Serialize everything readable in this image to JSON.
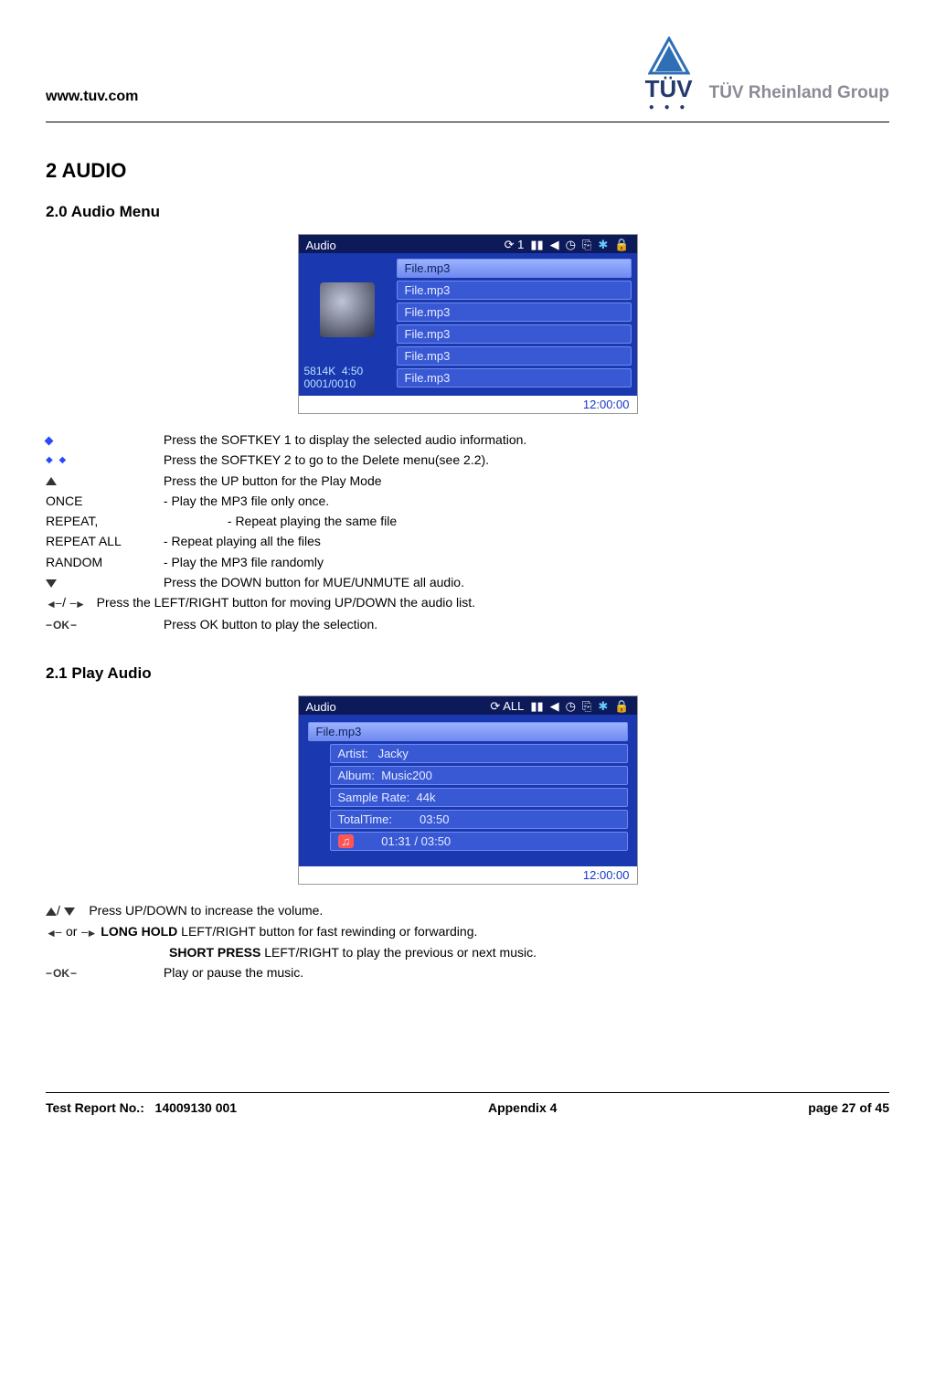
{
  "header": {
    "url": "www.tuv.com",
    "logo_text": "TÜV",
    "group_text": "TÜV Rheinland Group"
  },
  "section_heading": "2 AUDIO",
  "sub_20": "2.0 Audio Menu",
  "screen1": {
    "title": "Audio",
    "repeat_badge": "⟳ 1",
    "files": [
      "File.mp3",
      "File.mp3",
      "File.mp3",
      "File.mp3",
      "File.mp3",
      "File.mp3"
    ],
    "size": "5814K",
    "duration": "4:50",
    "index": "0001/0010",
    "clock": "12:00:00"
  },
  "instructions_20": {
    "softkey1": "Press the SOFTKEY 1 to display the selected audio information.",
    "softkey2": "Press the SOFTKEY 2 to go to the Delete menu(see 2.2).",
    "up": "Press the UP button for the Play Mode",
    "once_lbl": "ONCE",
    "once_txt": "- Play the MP3 file only once.",
    "repeat_lbl": "REPEAT,",
    "repeat_txt": "- Repeat playing the same file",
    "repeatall_lbl": "REPEAT ALL",
    "repeatall_txt": "- Repeat playing all the files",
    "random_lbl": "RANDOM",
    "random_txt": "- Play the MP3 file randomly",
    "down": "Press the DOWN button for MUE/UNMUTE all audio.",
    "lr": "Press the LEFT/RIGHT button for moving UP/DOWN the audio list.",
    "ok": "Press OK button to play the selection."
  },
  "sub_21": "2.1 Play Audio",
  "screen2": {
    "title": "Audio",
    "repeat_badge": "⟳ ALL",
    "file": "File.mp3",
    "artist_lbl": "Artist:",
    "artist_val": "Jacky",
    "album_lbl": "Album:",
    "album_val": "Music200",
    "rate_lbl": "Sample Rate:",
    "rate_val": "44k",
    "total_lbl": "TotalTime:",
    "total_val": "03:50",
    "progress": "01:31 / 03:50",
    "clock": "12:00:00"
  },
  "instructions_21": {
    "updown": "Press UP/DOWN to increase the volume.",
    "hold_prefix": "LONG HOLD",
    "hold_rest": " LEFT/RIGHT button for fast rewinding or forwarding.",
    "short_prefix": "SHORT PRESS",
    "short_rest": " LEFT/RIGHT to play the previous or next music.",
    "ok": "Play or pause the music.",
    "or": " or ",
    "slash": "/"
  },
  "footer": {
    "report_lbl": "Test Report No.:",
    "report_no": "14009130 001",
    "appendix": "Appendix 4",
    "page": "page 27 of 45"
  }
}
